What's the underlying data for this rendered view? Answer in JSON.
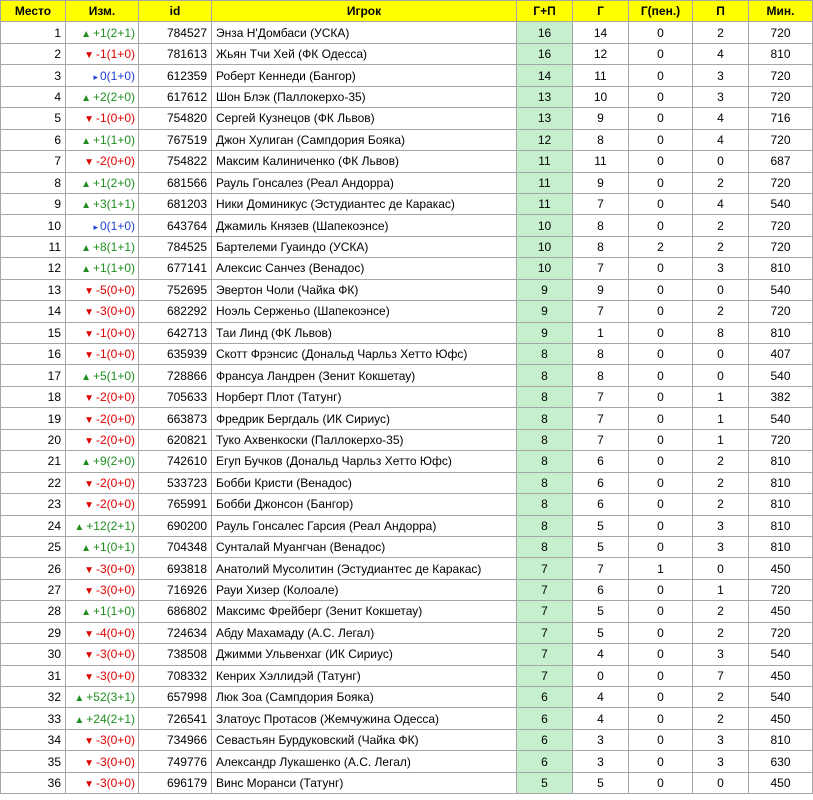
{
  "headers": [
    "Место",
    "Изм.",
    "id",
    "Игрок",
    "Г+П",
    "Г",
    "Г(пен.)",
    "П",
    "Мин."
  ],
  "rows": [
    {
      "place": "1",
      "dir": "up",
      "change": "+1(2+1)",
      "id": "784527",
      "player": "Энза Н'Домбаси (УСКА)",
      "gp": "16",
      "g": "14",
      "gpen": "0",
      "p": "2",
      "min": "720"
    },
    {
      "place": "2",
      "dir": "down",
      "change": "-1(1+0)",
      "id": "781613",
      "player": "Жьян Тчи Хей (ФК Одесса)",
      "gp": "16",
      "g": "12",
      "gpen": "0",
      "p": "4",
      "min": "810"
    },
    {
      "place": "3",
      "dir": "same",
      "change": "0(1+0)",
      "id": "612359",
      "player": "Роберт Кеннеди (Бангор)",
      "gp": "14",
      "g": "11",
      "gpen": "0",
      "p": "3",
      "min": "720"
    },
    {
      "place": "4",
      "dir": "up",
      "change": "+2(2+0)",
      "id": "617612",
      "player": "Шон Блэк (Паллокерхо-35)",
      "gp": "13",
      "g": "10",
      "gpen": "0",
      "p": "3",
      "min": "720"
    },
    {
      "place": "5",
      "dir": "down",
      "change": "-1(0+0)",
      "id": "754820",
      "player": "Сергей Кузнецов (ФК Львов)",
      "gp": "13",
      "g": "9",
      "gpen": "0",
      "p": "4",
      "min": "716"
    },
    {
      "place": "6",
      "dir": "up",
      "change": "+1(1+0)",
      "id": "767519",
      "player": "Джон Хулиган (Сампдория Бояка)",
      "gp": "12",
      "g": "8",
      "gpen": "0",
      "p": "4",
      "min": "720"
    },
    {
      "place": "7",
      "dir": "down",
      "change": "-2(0+0)",
      "id": "754822",
      "player": "Максим Калиниченко (ФК Львов)",
      "gp": "11",
      "g": "11",
      "gpen": "0",
      "p": "0",
      "min": "687"
    },
    {
      "place": "8",
      "dir": "up",
      "change": "+1(2+0)",
      "id": "681566",
      "player": "Рауль Гонсалез (Реал Андорра)",
      "gp": "11",
      "g": "9",
      "gpen": "0",
      "p": "2",
      "min": "720"
    },
    {
      "place": "9",
      "dir": "up",
      "change": "+3(1+1)",
      "id": "681203",
      "player": "Ники Доминикус (Эстудиантес де Каракас)",
      "gp": "11",
      "g": "7",
      "gpen": "0",
      "p": "4",
      "min": "540"
    },
    {
      "place": "10",
      "dir": "same",
      "change": "0(1+0)",
      "id": "643764",
      "player": "Джамиль Князев (Шапекоэнсе)",
      "gp": "10",
      "g": "8",
      "gpen": "0",
      "p": "2",
      "min": "720"
    },
    {
      "place": "11",
      "dir": "up",
      "change": "+8(1+1)",
      "id": "784525",
      "player": "Бартелеми Гуаиндо (УСКА)",
      "gp": "10",
      "g": "8",
      "gpen": "2",
      "p": "2",
      "min": "720"
    },
    {
      "place": "12",
      "dir": "up",
      "change": "+1(1+0)",
      "id": "677141",
      "player": "Алексис Санчез (Венадос)",
      "gp": "10",
      "g": "7",
      "gpen": "0",
      "p": "3",
      "min": "810"
    },
    {
      "place": "13",
      "dir": "down",
      "change": "-5(0+0)",
      "id": "752695",
      "player": "Эвертон Чоли (Чайка ФК)",
      "gp": "9",
      "g": "9",
      "gpen": "0",
      "p": "0",
      "min": "540"
    },
    {
      "place": "14",
      "dir": "down",
      "change": "-3(0+0)",
      "id": "682292",
      "player": "Ноэль Серженьо (Шапекоэнсе)",
      "gp": "9",
      "g": "7",
      "gpen": "0",
      "p": "2",
      "min": "720"
    },
    {
      "place": "15",
      "dir": "down",
      "change": "-1(0+0)",
      "id": "642713",
      "player": "Таи Линд (ФК Львов)",
      "gp": "9",
      "g": "1",
      "gpen": "0",
      "p": "8",
      "min": "810"
    },
    {
      "place": "16",
      "dir": "down",
      "change": "-1(0+0)",
      "id": "635939",
      "player": "Скотт Фрэнсис (Дональд Чарльз Хетто Юфс)",
      "gp": "8",
      "g": "8",
      "gpen": "0",
      "p": "0",
      "min": "407"
    },
    {
      "place": "17",
      "dir": "up",
      "change": "+5(1+0)",
      "id": "728866",
      "player": "Франсуа Ландрен (Зенит Кокшетау)",
      "gp": "8",
      "g": "8",
      "gpen": "0",
      "p": "0",
      "min": "540"
    },
    {
      "place": "18",
      "dir": "down",
      "change": "-2(0+0)",
      "id": "705633",
      "player": "Норберт Плот (Татунг)",
      "gp": "8",
      "g": "7",
      "gpen": "0",
      "p": "1",
      "min": "382"
    },
    {
      "place": "19",
      "dir": "down",
      "change": "-2(0+0)",
      "id": "663873",
      "player": "Фредрик Бергдаль (ИК Сириус)",
      "gp": "8",
      "g": "7",
      "gpen": "0",
      "p": "1",
      "min": "540"
    },
    {
      "place": "20",
      "dir": "down",
      "change": "-2(0+0)",
      "id": "620821",
      "player": "Туко Ахвенкоски (Паллокерхо-35)",
      "gp": "8",
      "g": "7",
      "gpen": "0",
      "p": "1",
      "min": "720"
    },
    {
      "place": "21",
      "dir": "up",
      "change": "+9(2+0)",
      "id": "742610",
      "player": "Егуп Бучков (Дональд Чарльз Хетто Юфс)",
      "gp": "8",
      "g": "6",
      "gpen": "0",
      "p": "2",
      "min": "810"
    },
    {
      "place": "22",
      "dir": "down",
      "change": "-2(0+0)",
      "id": "533723",
      "player": "Бобби Кристи (Венадос)",
      "gp": "8",
      "g": "6",
      "gpen": "0",
      "p": "2",
      "min": "810"
    },
    {
      "place": "23",
      "dir": "down",
      "change": "-2(0+0)",
      "id": "765991",
      "player": "Бобби Джонсон (Бангор)",
      "gp": "8",
      "g": "6",
      "gpen": "0",
      "p": "2",
      "min": "810"
    },
    {
      "place": "24",
      "dir": "up",
      "change": "+12(2+1)",
      "id": "690200",
      "player": "Рауль Гонсалес Гарсия (Реал Андорра)",
      "gp": "8",
      "g": "5",
      "gpen": "0",
      "p": "3",
      "min": "810"
    },
    {
      "place": "25",
      "dir": "up",
      "change": "+1(0+1)",
      "id": "704348",
      "player": "Сунталай Муангчан (Венадос)",
      "gp": "8",
      "g": "5",
      "gpen": "0",
      "p": "3",
      "min": "810"
    },
    {
      "place": "26",
      "dir": "down",
      "change": "-3(0+0)",
      "id": "693818",
      "player": "Анатолий Мусолитин (Эстудиантес де Каракас)",
      "gp": "7",
      "g": "7",
      "gpen": "1",
      "p": "0",
      "min": "450"
    },
    {
      "place": "27",
      "dir": "down",
      "change": "-3(0+0)",
      "id": "716926",
      "player": "Рауи Хизер (Колоале)",
      "gp": "7",
      "g": "6",
      "gpen": "0",
      "p": "1",
      "min": "720"
    },
    {
      "place": "28",
      "dir": "up",
      "change": "+1(1+0)",
      "id": "686802",
      "player": "Максимс Фрейберг (Зенит Кокшетау)",
      "gp": "7",
      "g": "5",
      "gpen": "0",
      "p": "2",
      "min": "450"
    },
    {
      "place": "29",
      "dir": "down",
      "change": "-4(0+0)",
      "id": "724634",
      "player": "Абду Махамаду (А.С. Легал)",
      "gp": "7",
      "g": "5",
      "gpen": "0",
      "p": "2",
      "min": "720"
    },
    {
      "place": "30",
      "dir": "down",
      "change": "-3(0+0)",
      "id": "738508",
      "player": "Джимми Ульвенхаг (ИК Сириус)",
      "gp": "7",
      "g": "4",
      "gpen": "0",
      "p": "3",
      "min": "540"
    },
    {
      "place": "31",
      "dir": "down",
      "change": "-3(0+0)",
      "id": "708332",
      "player": "Кенрих Хэллидэй (Татунг)",
      "gp": "7",
      "g": "0",
      "gpen": "0",
      "p": "7",
      "min": "450"
    },
    {
      "place": "32",
      "dir": "up",
      "change": "+52(3+1)",
      "id": "657998",
      "player": "Люк Зоа (Сампдория Бояка)",
      "gp": "6",
      "g": "4",
      "gpen": "0",
      "p": "2",
      "min": "540"
    },
    {
      "place": "33",
      "dir": "up",
      "change": "+24(2+1)",
      "id": "726541",
      "player": "Златоус Протасов (Жемчужина Одесса)",
      "gp": "6",
      "g": "4",
      "gpen": "0",
      "p": "2",
      "min": "450"
    },
    {
      "place": "34",
      "dir": "down",
      "change": "-3(0+0)",
      "id": "734966",
      "player": "Севастьян Бурдуковский (Чайка ФК)",
      "gp": "6",
      "g": "3",
      "gpen": "0",
      "p": "3",
      "min": "810"
    },
    {
      "place": "35",
      "dir": "down",
      "change": "-3(0+0)",
      "id": "749776",
      "player": "Александр Лукашенко (А.С. Легал)",
      "gp": "6",
      "g": "3",
      "gpen": "0",
      "p": "3",
      "min": "630"
    },
    {
      "place": "36",
      "dir": "down",
      "change": "-3(0+0)",
      "id": "696179",
      "player": "Винс Моранси (Татунг)",
      "gp": "5",
      "g": "5",
      "gpen": "0",
      "p": "0",
      "min": "450"
    }
  ],
  "icons": {
    "up": "triangle-up-icon",
    "down": "triangle-down-icon",
    "same": "triangle-right-icon"
  },
  "colors": {
    "header": "#ffff00",
    "gp_cell": "#c6efce",
    "up": "#1e8e1e",
    "down": "#e00000",
    "same": "#1f3fd6"
  }
}
